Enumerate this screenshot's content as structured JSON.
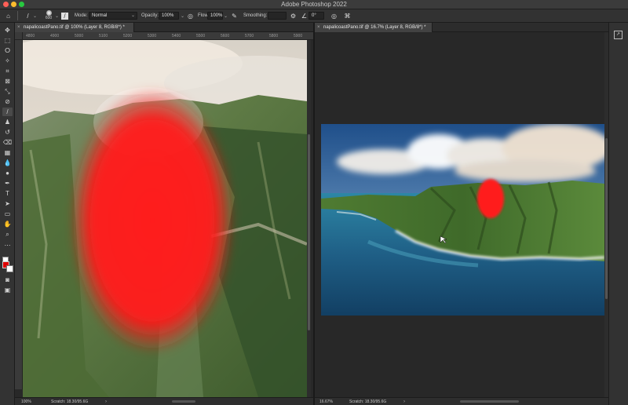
{
  "window": {
    "title": "Adobe Photoshop 2022"
  },
  "options_bar": {
    "brush_size": "600",
    "mode_label": "Mode:",
    "mode_value": "Normal",
    "opacity_label": "Opacity:",
    "opacity_value": "100%",
    "flow_label": "Flow:",
    "flow_value": "100%",
    "smoothing_label": "Smoothing:",
    "smoothing_value": "",
    "angle_value": "0°"
  },
  "documents": [
    {
      "tab_label": "napalicoastPano.tif @ 100% (Layer 8, RGB/8*) *",
      "ruler_ticks": [
        "4800",
        "4900",
        "5000",
        "5100",
        "5200",
        "5300",
        "5400",
        "5500",
        "5600",
        "5700",
        "5800",
        "5900"
      ],
      "zoom": "100%",
      "scratch": "Scratch: 18.30/95.6G"
    },
    {
      "tab_label": "napalicoastPano.tif @ 16.7% (Layer 8, RGB/8*) *",
      "zoom": "16.67%",
      "scratch": "Scratch: 18.30/95.6G"
    }
  ],
  "colors": {
    "foreground": "#e00000",
    "background": "#ffffff",
    "brush_stroke": "#ff1a1a"
  }
}
